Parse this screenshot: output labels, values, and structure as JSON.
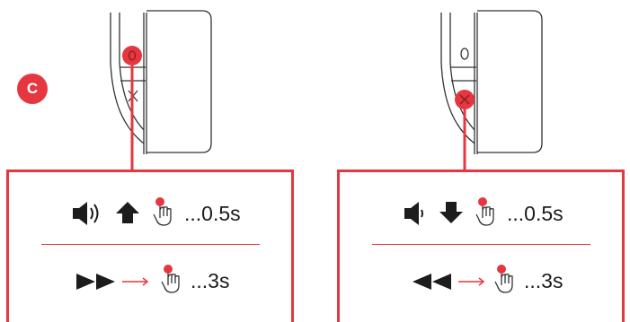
{
  "step_badge": "C",
  "accent_color": "#e5373f",
  "left_panel": {
    "top_row": {
      "volume_icon": "volume-up-icon",
      "direction_icon": "arrow-up-icon",
      "press_icon": "finger-press-icon",
      "duration": "...0.5s"
    },
    "bottom_row": {
      "skip_icon": "fast-forward-icon",
      "press_icon": "finger-press-icon",
      "duration": "...3s"
    },
    "highlighted_button": "O"
  },
  "right_panel": {
    "top_row": {
      "volume_icon": "volume-down-icon",
      "direction_icon": "arrow-down-icon",
      "press_icon": "finger-press-icon",
      "duration": "...0.5s"
    },
    "bottom_row": {
      "skip_icon": "rewind-icon",
      "press_icon": "finger-press-icon",
      "duration": "...3s"
    },
    "highlighted_button": "X"
  }
}
